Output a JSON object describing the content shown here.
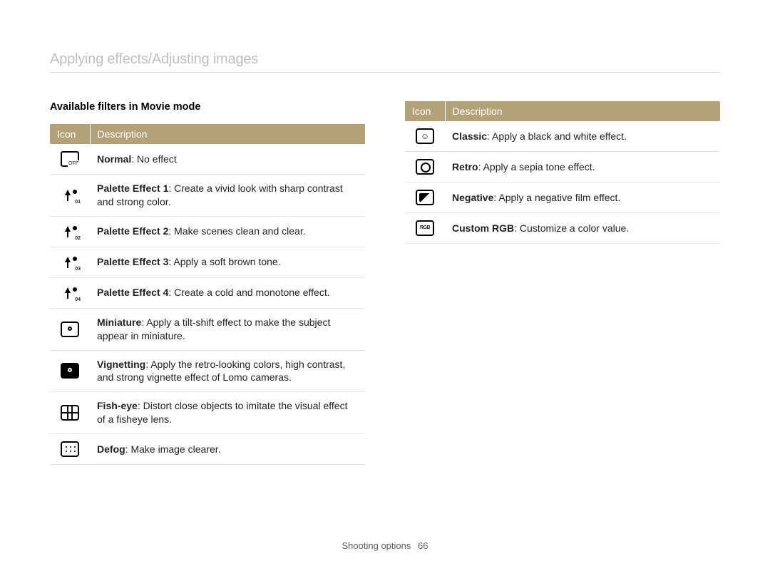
{
  "page_title": "Applying effects/Adjusting images",
  "section_heading": "Available filters in Movie mode",
  "table_headers": {
    "icon": "Icon",
    "description": "Description"
  },
  "left_filters": [
    {
      "icon": "normal-off-icon",
      "name": "Normal",
      "text": ": No effect"
    },
    {
      "icon": "palette-1-icon",
      "name": "Palette Effect 1",
      "text": ": Create a vivid look with sharp contrast and strong color."
    },
    {
      "icon": "palette-2-icon",
      "name": "Palette Effect 2",
      "text": ": Make scenes clean and clear."
    },
    {
      "icon": "palette-3-icon",
      "name": "Palette Effect 3",
      "text": ": Apply a soft brown tone."
    },
    {
      "icon": "palette-4-icon",
      "name": "Palette Effect 4",
      "text": ": Create a cold and monotone effect."
    },
    {
      "icon": "miniature-icon",
      "name": "Miniature",
      "text": ": Apply a tilt-shift effect to make the subject appear in miniature."
    },
    {
      "icon": "vignetting-icon",
      "name": "Vignetting",
      "text": ": Apply the retro-looking colors, high contrast, and strong vignette effect of Lomo cameras."
    },
    {
      "icon": "fisheye-icon",
      "name": "Fish-eye",
      "text": ": Distort close objects to imitate the visual effect of a fisheye lens."
    },
    {
      "icon": "defog-icon",
      "name": "Defog",
      "text": ": Make image clearer."
    }
  ],
  "right_filters": [
    {
      "icon": "classic-icon",
      "name": "Classic",
      "text": ": Apply a black and white effect."
    },
    {
      "icon": "retro-icon",
      "name": "Retro",
      "text": ": Apply a sepia tone effect."
    },
    {
      "icon": "negative-icon",
      "name": "Negative",
      "text": ": Apply a negative film effect."
    },
    {
      "icon": "custom-rgb-icon",
      "name": "Custom RGB",
      "text": ": Customize a color value."
    }
  ],
  "footer": {
    "section": "Shooting options",
    "page": "66"
  }
}
